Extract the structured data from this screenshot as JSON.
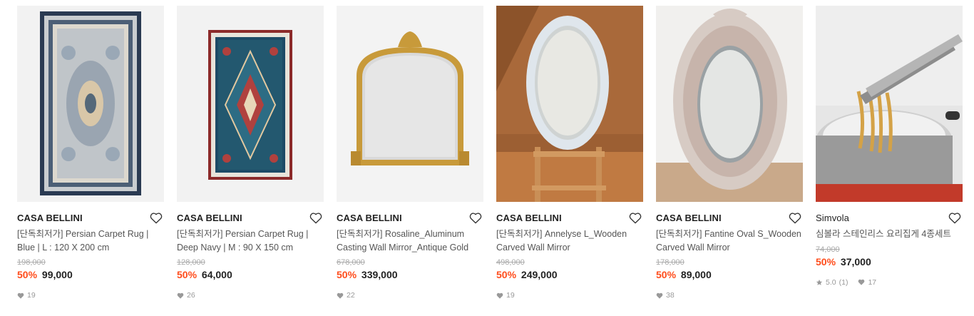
{
  "products": [
    {
      "brand": "CASA BELLINI",
      "title": "[단독최저가] Persian Carpet Rug | Blue | L : 120 X 200 cm",
      "original_price": "198,000",
      "discount": "50%",
      "price": "99,000",
      "likes": "19",
      "image": "rug-blue"
    },
    {
      "brand": "CASA BELLINI",
      "title": "[단독최저가] Persian Carpet Rug | Deep Navy | M : 90 X 150 cm",
      "original_price": "128,000",
      "discount": "50%",
      "price": "64,000",
      "likes": "26",
      "image": "rug-navy"
    },
    {
      "brand": "CASA BELLINI",
      "title": "[단독최저가] Rosaline_Aluminum Casting Wall Mirror_Antique Gold",
      "original_price": "678,000",
      "discount": "50%",
      "price": "339,000",
      "likes": "22",
      "image": "mirror-gold"
    },
    {
      "brand": "CASA BELLINI",
      "title": "[단독최저가] Annelyse L_Wooden Carved Wall Mirror",
      "original_price": "498,000",
      "discount": "50%",
      "price": "249,000",
      "likes": "19",
      "image": "mirror-white-oval"
    },
    {
      "brand": "CASA BELLINI",
      "title": "[단독최저가] Fantine Oval S_Wooden Carved Wall Mirror",
      "original_price": "178,000",
      "discount": "50%",
      "price": "89,000",
      "likes": "38",
      "image": "mirror-carved-oval"
    },
    {
      "brand": "Simvola",
      "title": "심볼라 스테인리스 요리집게 4종세트",
      "original_price": "74,000",
      "discount": "50%",
      "price": "37,000",
      "rating": "5.0",
      "reviews": "(1)",
      "likes": "17",
      "image": "tongs-noodles"
    }
  ],
  "colors": {
    "discount": "#ff4d1c",
    "brand": "#222222",
    "muted": "#999999"
  }
}
